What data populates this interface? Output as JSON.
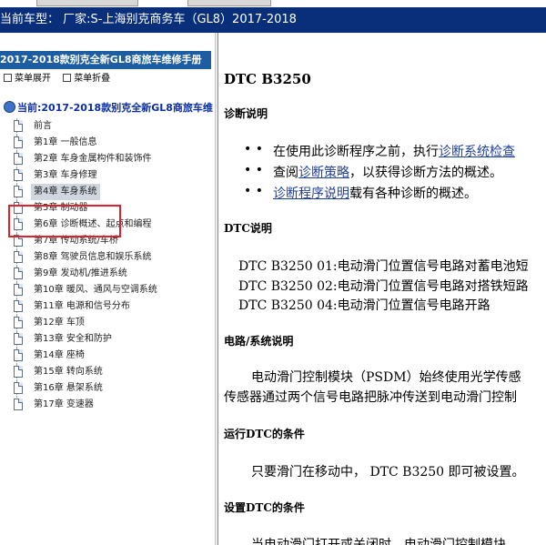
{
  "vehicle_bar": "当前车型： 厂家:S-上海别克商务车（GL8）2017-2018",
  "left": {
    "manual_title": "2017-2018款别克全新GL8商旅车维修手册",
    "menu_expand": "菜单展开",
    "menu_collapse": "菜单折叠",
    "current": "当前:2017-2018款别克全新GL8商旅车维",
    "items": [
      {
        "label": "前言"
      },
      {
        "label": "第1章 一般信息"
      },
      {
        "label": "第2章 车身金属构件和装饰件"
      },
      {
        "label": "第3章 车身修理"
      },
      {
        "label": "第4章 车身系统",
        "selected": true
      },
      {
        "label": "第5章 制动器"
      },
      {
        "label": "第6章 诊断概述、起点和编程"
      },
      {
        "label": "第7章 传动系统/车桥"
      },
      {
        "label": "第8章 驾驶员信息和娱乐系统"
      },
      {
        "label": "第9章 发动机/推进系统"
      },
      {
        "label": "第10章 暖风、通风与空调系统"
      },
      {
        "label": "第11章 电源和信号分布"
      },
      {
        "label": "第12章 车顶"
      },
      {
        "label": "第13章 安全和防护"
      },
      {
        "label": "第14章 座椅"
      },
      {
        "label": "第15章 转向系统"
      },
      {
        "label": "第16章 悬架系统"
      },
      {
        "label": "第17章 变速器"
      }
    ]
  },
  "doc": {
    "title": "DTC B3250",
    "diag_heading": "诊断说明",
    "b1_pre": "在使用此诊断程序之前，执行",
    "b1_link": "诊断系统检查",
    "b2_pre": "查阅",
    "b2_link": "诊断策略",
    "b2_post": "，以获得诊断方法的概述。",
    "b3_link": "诊断程序说明",
    "b3_post": "载有各种诊断的概述。",
    "dtc_heading": "DTC说明",
    "dtc1": "DTC B3250 01:电动滑门位置信号电路对蓄电池短",
    "dtc2": "DTC B3250 02:电动滑门位置信号电路对搭铁短路",
    "dtc3": "DTC B3250 04:电动滑门位置信号电路开路",
    "circuit_heading": "电路/系统说明",
    "circuit_p1": "电动滑门控制模块（PSDM）始终使用光学传感",
    "circuit_p2": "传感器通过两个信号电路把脉冲传送到电动滑门控制",
    "run_heading": "运行DTC的条件",
    "run_p": "只要滑门在移动中， DTC B3250 即可被设置。",
    "set_heading": "设置DTC的条件",
    "set_p": "当电动滑门打开或关闭时，电动滑门控制模块"
  }
}
